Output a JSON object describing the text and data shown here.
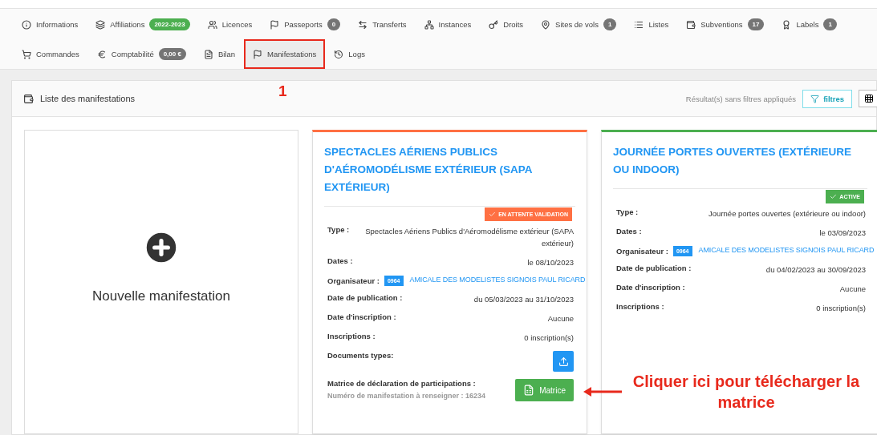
{
  "tabs": [
    {
      "label": "Informations",
      "selected": false,
      "highlighted": false
    },
    {
      "label": "Affiliations",
      "badge": {
        "text": "2022-2023",
        "color": "#4caf50"
      },
      "selected": false,
      "highlighted": false
    },
    {
      "label": "Licences",
      "selected": false,
      "highlighted": false
    },
    {
      "label": "Passeports",
      "badge": {
        "text": "0",
        "color": "#757575"
      },
      "selected": false,
      "highlighted": false
    },
    {
      "label": "Transferts",
      "selected": false,
      "highlighted": false
    },
    {
      "label": "Instances",
      "selected": false,
      "highlighted": false
    },
    {
      "label": "Droits",
      "selected": false,
      "highlighted": false
    },
    {
      "label": "Sites de vols",
      "badge": {
        "text": "1",
        "color": "#757575"
      },
      "selected": false,
      "highlighted": false
    },
    {
      "label": "Listes",
      "selected": false,
      "highlighted": false
    },
    {
      "label": "Subventions",
      "badge": {
        "text": "17",
        "color": "#757575"
      },
      "selected": false,
      "highlighted": false
    },
    {
      "label": "Labels",
      "badge": {
        "text": "1",
        "color": "#757575"
      },
      "selected": false,
      "highlighted": false
    },
    {
      "label": "Commandes",
      "selected": false,
      "highlighted": false
    },
    {
      "label": "Comptabilité",
      "badge": {
        "text": "0,00 €",
        "color": "#757575"
      },
      "selected": false,
      "highlighted": false
    },
    {
      "label": "Bilan",
      "selected": false,
      "highlighted": false
    },
    {
      "label": "Manifestations",
      "selected": true,
      "highlighted": true
    },
    {
      "label": "Logs",
      "selected": false,
      "highlighted": false
    }
  ],
  "panel": {
    "title": "Liste des manifestations",
    "filter_status": "Résultat(s) sans filtres appliqués",
    "filter_button": "filtres"
  },
  "cards": [
    {
      "kind": "new",
      "label": "Nouvelle manifestation"
    },
    {
      "kind": "event",
      "title": "SPECTACLES AÉRIENS PUBLICS D'AÉROMODÉLISME EXTÉRIEUR (SAPA EXTÉRIEUR)",
      "status": {
        "label": "EN ATTENTE VALIDATION",
        "color": "#ff7043"
      },
      "rows": [
        {
          "kind": "text",
          "label": "Type :",
          "value": "Spectacles Aériens Publics d'Aéromodélisme extérieur (SAPA extérieur)"
        },
        {
          "kind": "text",
          "label": "Dates :",
          "value": "le 08/10/2023"
        },
        {
          "kind": "organizer",
          "label": "Organisateur :",
          "code": "0964",
          "name": "AMICALE DES MODELISTES SIGNOIS PAUL RICARD"
        },
        {
          "kind": "text",
          "label": "Date de publication :",
          "value": "du 05/03/2023 au 31/10/2023"
        },
        {
          "kind": "text",
          "label": "Date d'inscription :",
          "value": "Aucune"
        },
        {
          "kind": "text",
          "label": "Inscriptions :",
          "value": "0 inscription(s)"
        },
        {
          "kind": "upload",
          "label": "Documents types:"
        },
        {
          "kind": "matrix",
          "label": "Matrice de déclaration de participations :",
          "note": "Numéro de manifestation à renseigner : 16234",
          "button": "Matrice"
        }
      ]
    },
    {
      "kind": "event",
      "title": "JOURNÉE PORTES OUVERTES (EXTÉRIEURE OU INDOOR)",
      "status": {
        "label": "ACTIVE",
        "color": "#4caf50"
      },
      "rows": [
        {
          "kind": "text",
          "label": "Type :",
          "value": "Journée portes ouvertes (extérieure ou indoor)"
        },
        {
          "kind": "text",
          "label": "Dates :",
          "value": "le 03/09/2023"
        },
        {
          "kind": "organizer",
          "label": "Organisateur :",
          "code": "0964",
          "name": "AMICALE DES MODELISTES SIGNOIS PAUL RICARD"
        },
        {
          "kind": "text",
          "label": "Date de publication :",
          "value": "du 04/02/2023 au 30/09/2023"
        },
        {
          "kind": "text",
          "label": "Date d'inscription :",
          "value": "Aucune"
        },
        {
          "kind": "text",
          "label": "Inscriptions :",
          "value": "0 inscription(s)"
        }
      ]
    }
  ],
  "annotations": {
    "step_number": "1",
    "callout": "Cliquer ici pour télécharger la matrice"
  }
}
